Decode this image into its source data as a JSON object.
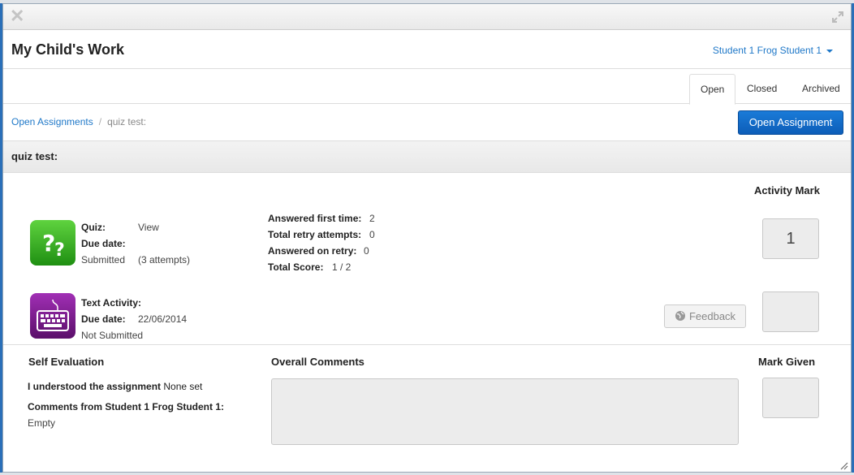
{
  "window": {
    "title": "My Child's Work"
  },
  "student_select": {
    "label": "Student 1 Frog Student 1"
  },
  "tabs": [
    {
      "label": "Open",
      "active": true
    },
    {
      "label": "Closed",
      "active": false
    },
    {
      "label": "Archived",
      "active": false
    }
  ],
  "breadcrumb": {
    "link": "Open Assignments",
    "separator": "/",
    "current": "quiz test:"
  },
  "open_button": {
    "label": "Open Assignment"
  },
  "assignment": {
    "title": "quiz test:"
  },
  "activity_mark_label": "Activity Mark",
  "quiz": {
    "type_label": "Quiz:",
    "type_value": "View",
    "due_label": "Due date:",
    "status": "Submitted",
    "attempts": "(3 attempts)",
    "stats": [
      {
        "label": "Answered first time:",
        "value": "2"
      },
      {
        "label": "Total retry attempts:",
        "value": "0"
      },
      {
        "label": "Answered on retry:",
        "value": "0"
      },
      {
        "label": "Total Score:",
        "value": "1 / 2"
      }
    ],
    "mark": "1"
  },
  "text_activity": {
    "type_label": "Text Activity:",
    "due_label": "Due date:",
    "due_value": "22/06/2014",
    "status": "Not Submitted",
    "feedback_label": "Feedback",
    "mark": ""
  },
  "self_evaluation": {
    "heading": "Self Evaluation",
    "understood_label": "I understood the assignment",
    "understood_value": "None set",
    "comments_label": "Comments from Student 1 Frog Student 1:",
    "comments_value": "Empty"
  },
  "overall_comments": {
    "heading": "Overall Comments"
  },
  "mark_given": {
    "heading": "Mark Given",
    "value": ""
  },
  "colors": {
    "accent": "#1f78c8",
    "primary_button": "#0d5db8",
    "quiz_icon": "#3bb32a",
    "text_icon": "#7a1e8e"
  },
  "icons": {
    "close": "close-icon",
    "expand": "expand-icon",
    "feedback": "globe-icon",
    "quiz": "question-icon",
    "text": "keyboard-icon"
  }
}
